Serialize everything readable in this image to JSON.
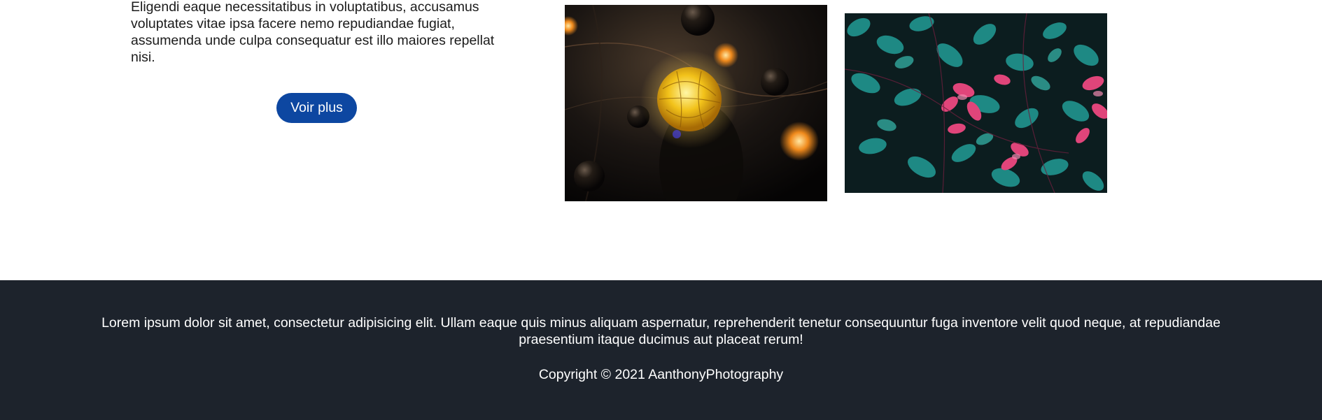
{
  "intro": {
    "paragraph": "Eligendi eaque necessitatibus in voluptatibus, accusamus voluptates vitae ipsa facere nemo repudiandae fugiat, assumenda unde culpa consequatur est illo maiores repellat nisi."
  },
  "actions": {
    "voir_plus_label": "Voir plus"
  },
  "gallery": {
    "images": [
      {
        "subject": "string-lights-photo"
      },
      {
        "subject": "teal-and-pink-leaves-photo"
      }
    ]
  },
  "footer": {
    "text": "Lorem ipsum dolor sit amet, consectetur adipisicing elit. Ullam eaque quis minus aliquam aspernatur, reprehenderit tenetur consequuntur fuga inventore velit quod neque, at repudiandae praesentium itaque ducimus aut placeat rerum!",
    "copyright": "Copyright © 2021 AanthonyPhotography"
  },
  "colors": {
    "button_background": "#0d47a1",
    "footer_background": "#1d232c",
    "footer_text": "#ffffff"
  }
}
